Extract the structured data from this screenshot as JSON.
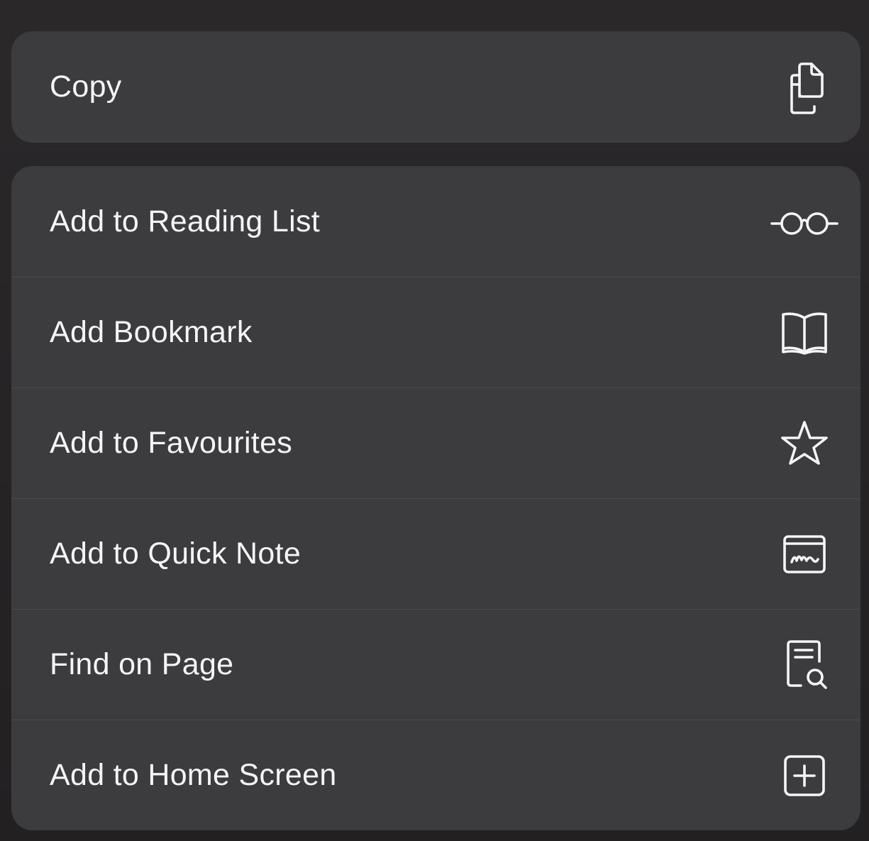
{
  "share_menu": {
    "copy_group": [
      {
        "label": "Copy",
        "icon": "copy-icon"
      }
    ],
    "action_group": [
      {
        "label": "Add to Reading List",
        "icon": "glasses-icon"
      },
      {
        "label": "Add Bookmark",
        "icon": "book-icon"
      },
      {
        "label": "Add to Favourites",
        "icon": "star-icon"
      },
      {
        "label": "Add to Quick Note",
        "icon": "quick-note-icon"
      },
      {
        "label": "Find on Page",
        "icon": "find-on-page-icon"
      },
      {
        "label": "Add to Home Screen",
        "icon": "add-square-icon"
      }
    ]
  },
  "colors": {
    "background": "#252324",
    "panel": "#3c3c3e",
    "separator": "#4a4a4c",
    "text": "#f5f5f7"
  }
}
